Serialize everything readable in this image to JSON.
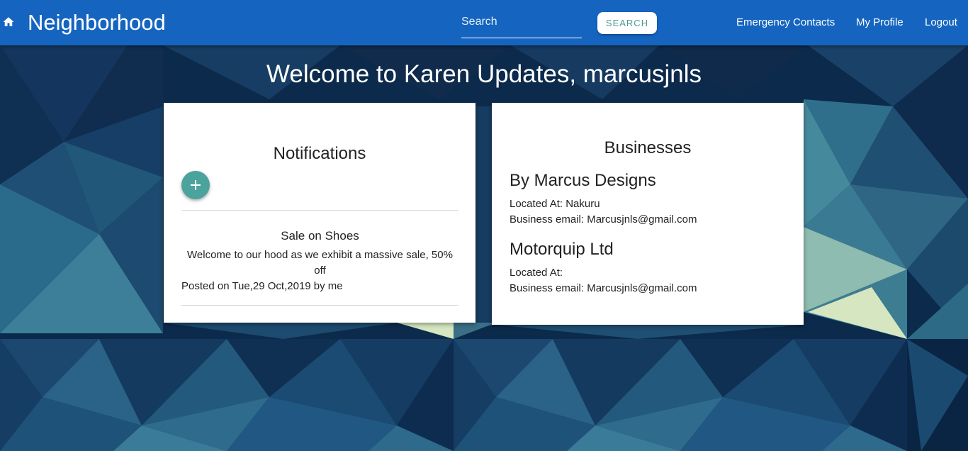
{
  "navbar": {
    "brand": "Neighborhood",
    "search_placeholder": "Search",
    "search_button": "SEARCH",
    "links": [
      "Emergency Contacts",
      "My Profile",
      "Logout"
    ],
    "color": "#1565c0"
  },
  "welcome": "Welcome to Karen Updates, marcusjnls",
  "notifications": {
    "title": "Notifications",
    "add_icon": "plus-icon",
    "items": [
      {
        "title": "Sale on Shoes",
        "body": "Welcome to our hood as we exhibit a massive sale, 50% off",
        "meta": "Posted on Tue,29 Oct,2019 by me"
      }
    ]
  },
  "businesses": {
    "title": "Businesses",
    "items": [
      {
        "name": "By Marcus Designs",
        "location": "Located At: Nakuru",
        "email": "Business email: Marcusjnls@gmail.com"
      },
      {
        "name": "Motorquip Ltd",
        "location": "Located At:",
        "email": "Business email: Marcusjnls@gmail.com"
      }
    ]
  },
  "colors": {
    "accent": "#4aa39c",
    "background": "#0b2442"
  }
}
